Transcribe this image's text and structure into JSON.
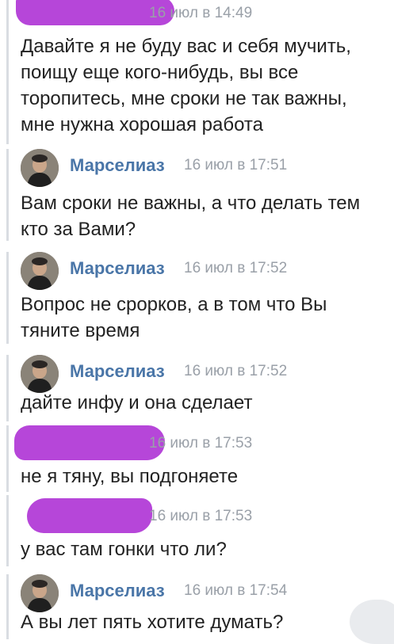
{
  "messages": [
    {
      "redacted_sender": true,
      "time": "16 июл в 14:49",
      "lines": [
        "Давайте я не буду вас и себя мучить,",
        "поищу еще кого-нибудь, вы все",
        "торопитесь, мне сроки не так важны,",
        "мне нужна хорошая работа"
      ]
    },
    {
      "sender": "Марселиаз",
      "avatar_icon": "user-avatar-photo",
      "time": "16 июл в 17:51",
      "lines": [
        "Вам сроки не важны, а что делать тем",
        "кто за Вами?"
      ]
    },
    {
      "sender": "Марселиаз",
      "avatar_icon": "user-avatar-photo",
      "time": "16 июл в 17:52",
      "lines": [
        "Вопрос не срорков, а в том что Вы",
        "тяните время"
      ]
    },
    {
      "sender": "Марселиаз",
      "avatar_icon": "user-avatar-photo",
      "time": "16 июл в 17:52",
      "lines": [
        "дайте инфу и она сделает"
      ]
    },
    {
      "redacted_sender": true,
      "time": "16 июл в 17:53",
      "lines": [
        "не я тяну, вы подгоняете"
      ]
    },
    {
      "redacted_sender": true,
      "time": "16 июл в 17:53",
      "lines": [
        "у вас там гонки что ли?"
      ]
    },
    {
      "sender": "Марселиаз",
      "avatar_icon": "user-avatar-photo",
      "time": "16 июл в 17:54",
      "lines": [
        "А вы лет пять хотите думать?"
      ]
    }
  ],
  "colors": {
    "sender_name": "#4a76a8",
    "timestamp": "#9aa0a8",
    "redaction": "#b646d9",
    "thread_bar": "#d9dde2"
  }
}
